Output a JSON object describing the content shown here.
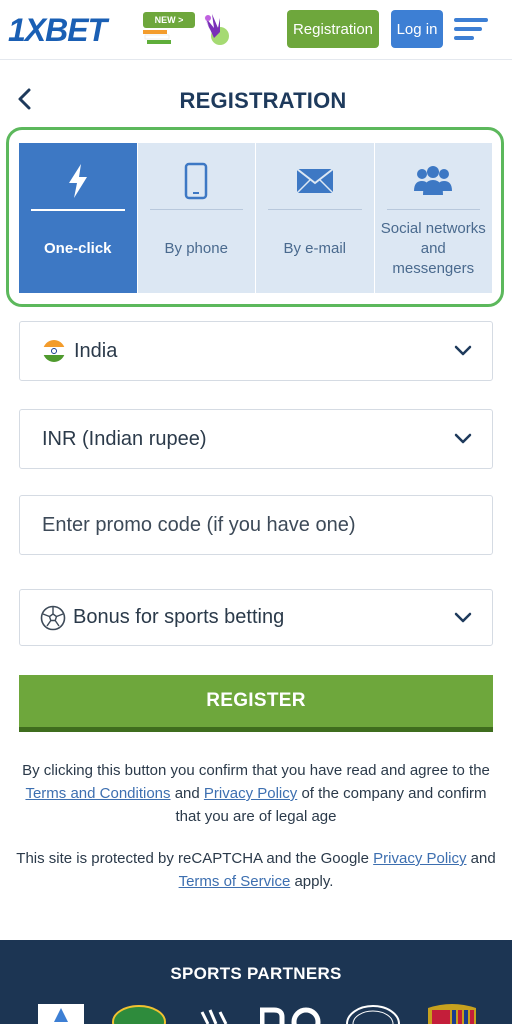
{
  "header": {
    "logo_text": "1XBET",
    "new_badge": "NEW >",
    "registration_label": "Registration",
    "login_label": "Log in",
    "accent_green": "#6ea73c",
    "accent_blue": "#3d7fd4"
  },
  "page": {
    "title": "REGISTRATION"
  },
  "tabs": [
    {
      "label": "One-click",
      "icon": "lightning-icon",
      "active": true
    },
    {
      "label": "By phone",
      "icon": "phone-icon",
      "active": false
    },
    {
      "label": "By e-mail",
      "icon": "envelope-icon",
      "active": false
    },
    {
      "label": "Social networks and messengers",
      "icon": "group-icon",
      "active": false
    }
  ],
  "form": {
    "country": {
      "value": "India",
      "icon": "india-flag-icon"
    },
    "currency": {
      "value": "INR (Indian rupee)"
    },
    "promo": {
      "placeholder": "Enter promo code (if you have one)"
    },
    "bonus": {
      "value": "Bonus for sports betting",
      "icon": "soccer-ball-icon"
    },
    "register_label": "REGISTER"
  },
  "legal": {
    "line1_pre": "By clicking this button you confirm that you have read and agree to the",
    "terms_link": "Terms and Conditions",
    "and1": "and",
    "privacy_link": "Privacy Policy",
    "line1_post": "of the company and confirm that you are of legal age",
    "line2_pre": "This site is protected by reCAPTCHA and the Google",
    "privacy_link2": "Privacy Policy",
    "and2": "and",
    "tos_link": "Terms of Service",
    "line2_post": "apply."
  },
  "footer": {
    "title": "SPORTS PARTNERS",
    "background": "#1c3553"
  }
}
